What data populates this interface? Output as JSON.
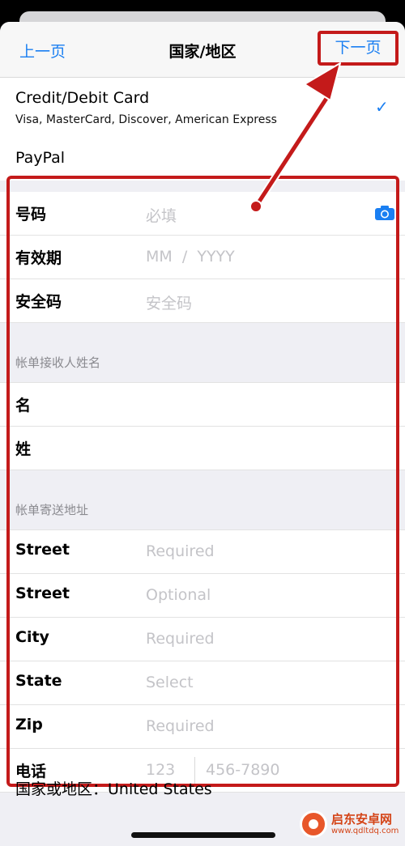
{
  "nav": {
    "back": "上一页",
    "title": "国家/地区",
    "next": "下一页"
  },
  "payment_methods": [
    {
      "name": "Credit/Debit Card",
      "detail": "Visa, MasterCard, Discover, American Express",
      "selected": true
    },
    {
      "name": "PayPal",
      "detail": "",
      "selected": false
    }
  ],
  "card_fields": [
    {
      "label": "号码",
      "placeholder": "必填"
    },
    {
      "label": "有效期",
      "placeholder": "MM  /  YYYY"
    },
    {
      "label": "安全码",
      "placeholder": "安全码"
    }
  ],
  "billing_name": {
    "header": "帐单接收人姓名",
    "fields": [
      {
        "label": "名",
        "placeholder": ""
      },
      {
        "label": "姓",
        "placeholder": ""
      }
    ]
  },
  "billing_address": {
    "header": "帐单寄送地址",
    "fields": [
      {
        "label": "Street",
        "placeholder": "Required"
      },
      {
        "label": "Street",
        "placeholder": "Optional"
      },
      {
        "label": "City",
        "placeholder": "Required"
      },
      {
        "label": "State",
        "placeholder": "Select"
      },
      {
        "label": "Zip",
        "placeholder": "Required"
      }
    ],
    "phone": {
      "label": "电话",
      "area_placeholder": "123",
      "number_placeholder": "456-7890"
    }
  },
  "country": {
    "label": "国家或地区：",
    "value": "United States"
  },
  "watermark": {
    "name": "启东安卓网",
    "url": "www.qdltdq.com"
  },
  "colors": {
    "accent": "#1a7ff2",
    "annotation": "#c41a1a",
    "placeholder": "#c4c4c8"
  },
  "icons": {
    "selected": "checkmark-icon",
    "scan": "camera-icon"
  }
}
